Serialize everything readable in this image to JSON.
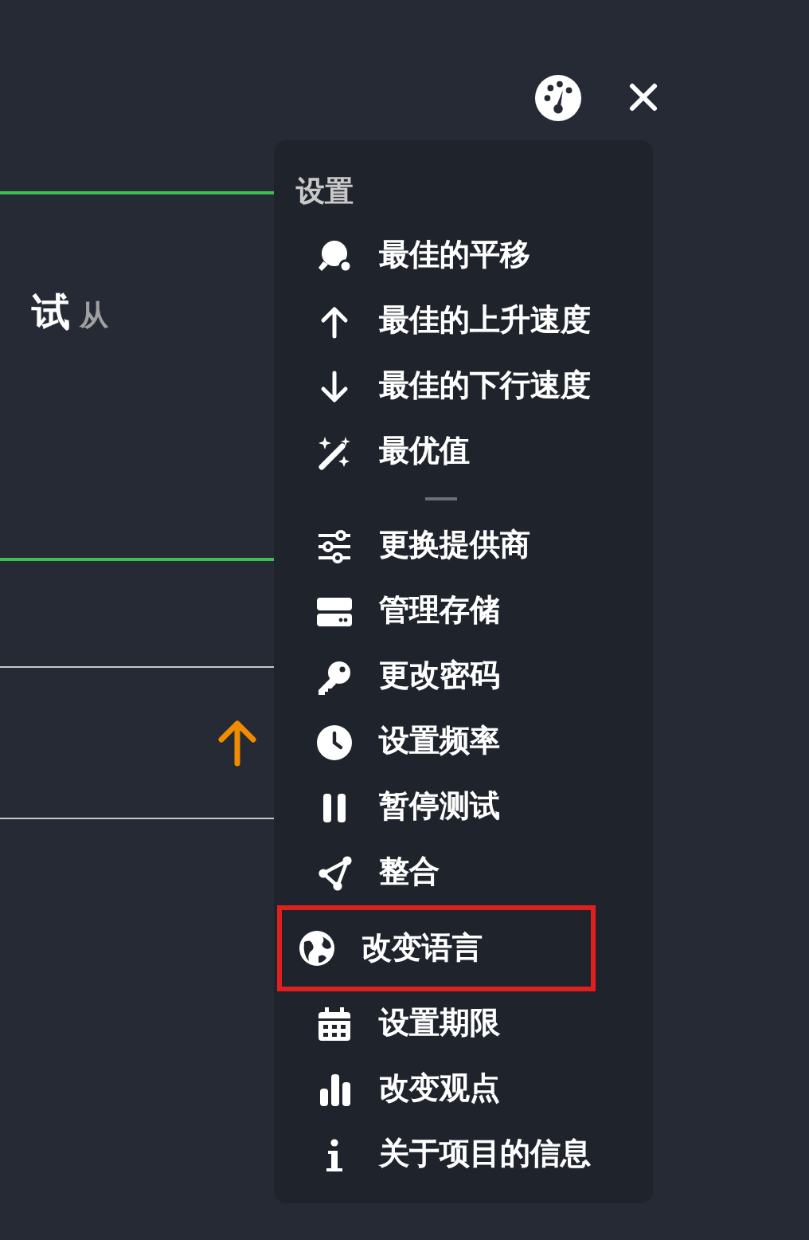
{
  "background": {
    "heading": "试",
    "heading_suffix": "从"
  },
  "menu": {
    "title": "设置",
    "items": [
      {
        "kind": "item",
        "label": "最佳的平移",
        "highlighted": false
      },
      {
        "kind": "item",
        "label": "最佳的上升速度",
        "highlighted": false
      },
      {
        "kind": "item",
        "label": "最佳的下行速度",
        "highlighted": false
      },
      {
        "kind": "item",
        "label": "最优值",
        "highlighted": false
      },
      {
        "kind": "divider"
      },
      {
        "kind": "item",
        "label": "更换提供商",
        "highlighted": false
      },
      {
        "kind": "item",
        "label": "管理存储",
        "highlighted": false
      },
      {
        "kind": "item",
        "label": "更改密码",
        "highlighted": false
      },
      {
        "kind": "item",
        "label": "设置频率",
        "highlighted": false
      },
      {
        "kind": "item",
        "label": "暂停测试",
        "highlighted": false
      },
      {
        "kind": "item",
        "label": "整合",
        "highlighted": false
      },
      {
        "kind": "item",
        "label": "改变语言",
        "highlighted": true
      },
      {
        "kind": "item",
        "label": "设置期限",
        "highlighted": false
      },
      {
        "kind": "item",
        "label": "改变观点",
        "highlighted": false
      },
      {
        "kind": "item",
        "label": "关于项目的信息",
        "highlighted": false
      }
    ]
  }
}
